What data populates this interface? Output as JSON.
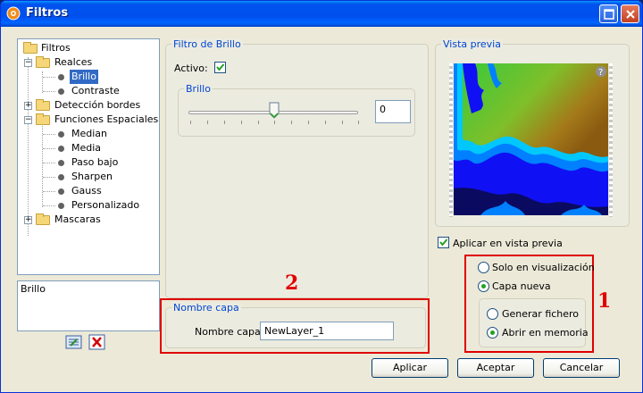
{
  "window": {
    "title": "Filtros"
  },
  "tree": {
    "root": "Filtros",
    "items": [
      {
        "label": "Realces",
        "type": "folder"
      },
      {
        "label": "Brillo",
        "type": "leaf",
        "selected": true
      },
      {
        "label": "Contraste",
        "type": "leaf"
      },
      {
        "label": "Detección bordes",
        "type": "folder"
      },
      {
        "label": "Funciones Espaciales",
        "type": "folder"
      },
      {
        "label": "Median",
        "type": "leaf"
      },
      {
        "label": "Media",
        "type": "leaf"
      },
      {
        "label": "Paso bajo",
        "type": "leaf"
      },
      {
        "label": "Sharpen",
        "type": "leaf"
      },
      {
        "label": "Gauss",
        "type": "leaf"
      },
      {
        "label": "Personalizado",
        "type": "leaf"
      },
      {
        "label": "Mascaras",
        "type": "folder"
      }
    ]
  },
  "description": "Brillo",
  "filter_panel": {
    "title": "Filtro de Brillo",
    "active_label": "Activo:",
    "active_checked": true,
    "slider_group_title": "Brillo",
    "slider_value": "0"
  },
  "preview": {
    "title": "Vista previa",
    "help_icon": "question-icon",
    "apply_preview_label": "Aplicar en vista previa",
    "apply_preview_checked": true
  },
  "output_options": {
    "only_view_label": "Solo en visualización",
    "new_layer_label": "Capa nueva",
    "new_layer_selected": true,
    "generate_file_label": "Generar fichero",
    "open_memory_label": "Abrir en memoria",
    "open_memory_selected": true
  },
  "layer_name": {
    "panel_title": "Nombre capa",
    "field_label": "Nombre capa:",
    "value": "NewLayer_1"
  },
  "annotations": {
    "one": "1",
    "two": "2"
  },
  "buttons": {
    "apply": "Aplicar",
    "accept": "Aceptar",
    "cancel": "Cancelar"
  },
  "colors": {
    "highlight": "#e00000",
    "title_blue": "#0046d5",
    "selection": "#316ac5"
  }
}
